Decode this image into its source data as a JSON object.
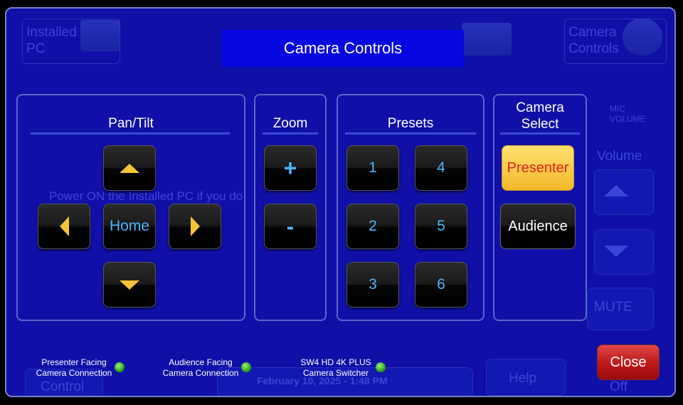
{
  "modal": {
    "title": "Camera Controls"
  },
  "pan_tilt": {
    "title": "Pan/Tilt",
    "home_label": "Home"
  },
  "zoom": {
    "title": "Zoom",
    "in_label": "+",
    "out_label": "-"
  },
  "presets": {
    "title": "Presets",
    "buttons": [
      "1",
      "4",
      "2",
      "5",
      "3",
      "6"
    ]
  },
  "camera_select": {
    "title_line1": "Camera",
    "title_line2": "Select",
    "presenter_label": "Presenter",
    "audience_label": "Audience",
    "selected": "Presenter"
  },
  "status_indicators": [
    {
      "line1": "Presenter Facing",
      "line2": "Camera Connection",
      "connected": true
    },
    {
      "line1": "Audience Facing",
      "line2": "Camera Connection",
      "connected": true
    },
    {
      "line1": "SW4 HD 4K PLUS",
      "line2": "Camera Switcher",
      "connected": true
    }
  ],
  "close_label": "Close",
  "background": {
    "tab_installed_pc_line1": "Installed",
    "tab_installed_pc_line2": "PC",
    "tab_camera_line1": "Camera",
    "tab_camera_line2": "Controls",
    "mic_volume_line1": "MIC",
    "mic_volume_line2": "VOLUME",
    "volume_label": "Volume",
    "mute_label": "MUTE",
    "help_label": "Help",
    "control_label": "Control",
    "off_label": "Off",
    "date_time": "February 10, 2025  -  1:48 PM",
    "power_message": "Power ON the Installed PC if you do"
  },
  "colors": {
    "panel_background": "#1010a8",
    "title_bar": "#0606e0",
    "button_text": "#4db4ff",
    "arrow": "#f7c437",
    "presenter_active": "#f6c33c",
    "presenter_text": "#e02020",
    "close_button": "#c01a1a",
    "led": "#2fa61a"
  }
}
